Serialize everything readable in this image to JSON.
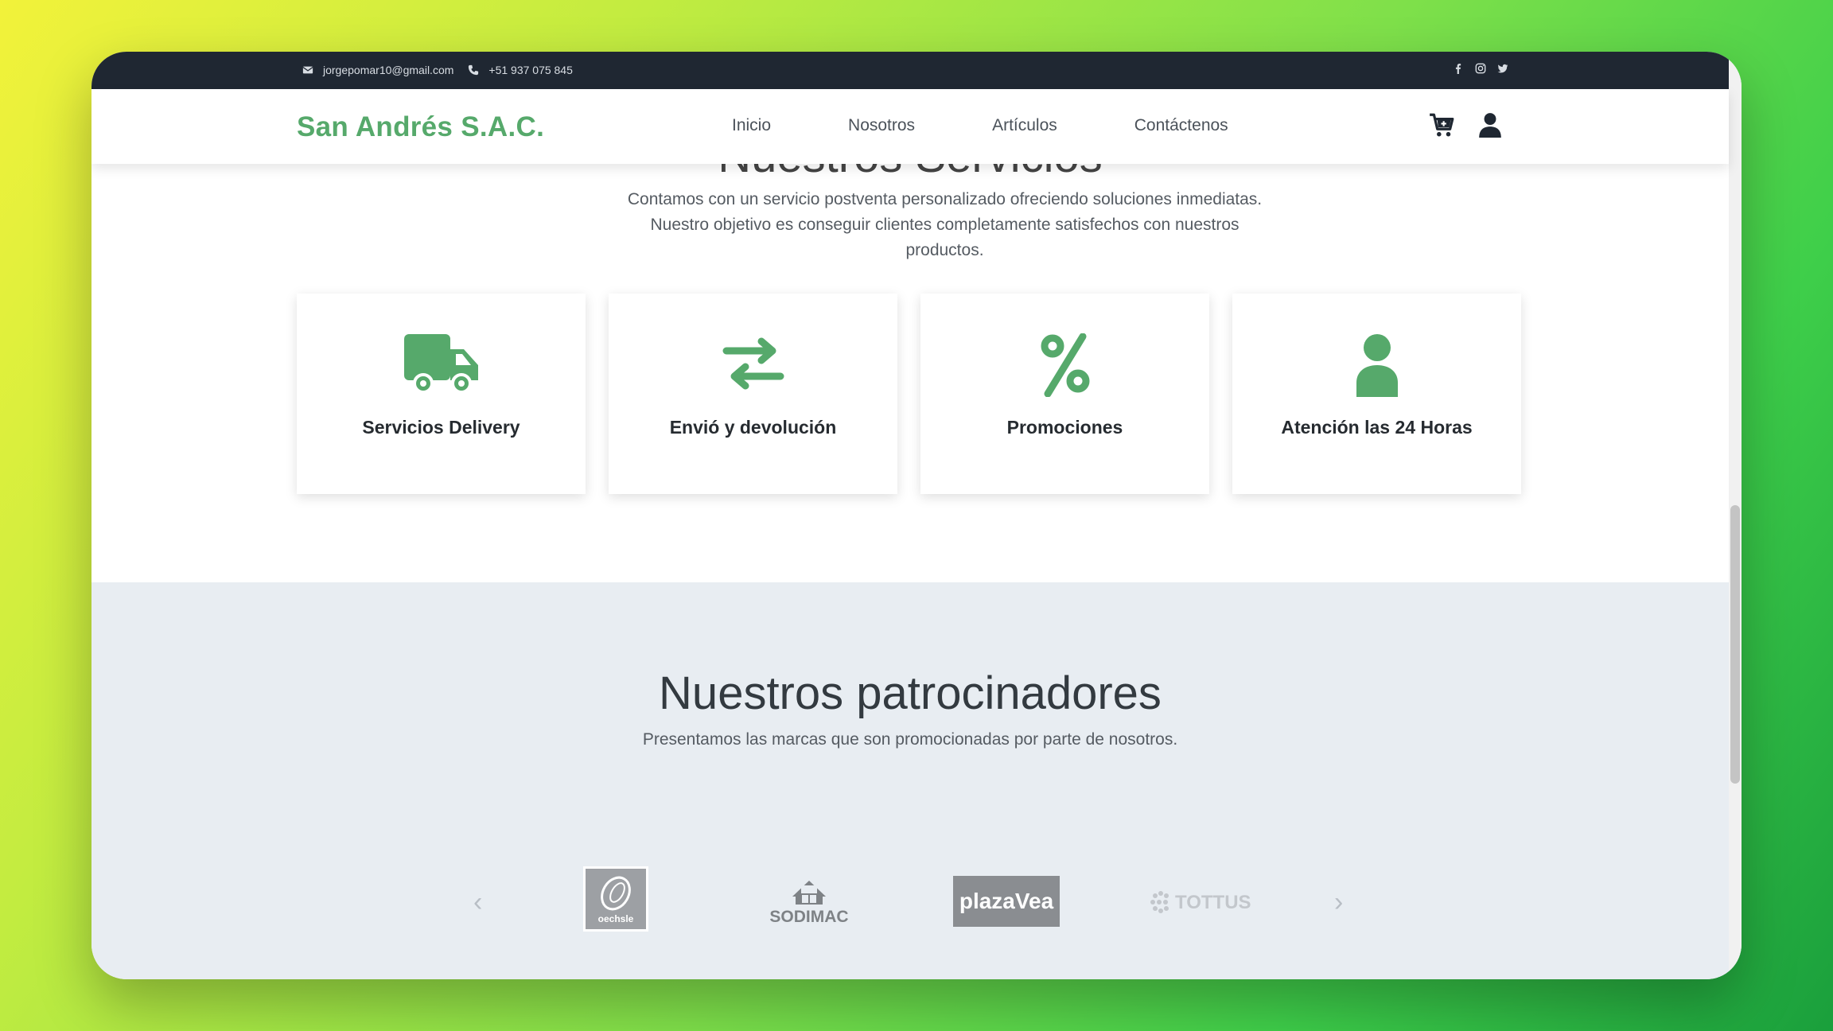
{
  "topbar": {
    "email": "jorgepomar10@gmail.com",
    "phone": "+51 937 075 845",
    "social": [
      "facebook-icon",
      "instagram-icon",
      "twitter-icon"
    ]
  },
  "navbar": {
    "brand": "San Andrés S.A.C.",
    "menu": [
      "Inicio",
      "Nosotros",
      "Artículos",
      "Contáctenos"
    ],
    "icons": [
      "cart-plus-icon",
      "user-icon"
    ]
  },
  "services": {
    "title": "Nuestros Servicios",
    "description": "Contamos con un servicio postventa personalizado ofreciendo soluciones inmediatas. Nuestro objetivo es conseguir clientes completamente satisfechos con nuestros productos.",
    "cards": [
      {
        "label": "Servicios Delivery",
        "icon": "truck-icon"
      },
      {
        "label": "Envió y devolución",
        "icon": "exchange-arrows-icon"
      },
      {
        "label": "Promociones",
        "icon": "percent-icon"
      },
      {
        "label": "Atención las 24 Horas",
        "icon": "user-icon"
      }
    ]
  },
  "sponsors": {
    "title": "Nuestros patrocinadores",
    "subtitle": "Presentamos las marcas que son promocionadas por parte de nosotros.",
    "logos": [
      "oechsle",
      "SODIMAC",
      "plazaVea",
      "TOTTUS"
    ],
    "prev": "‹",
    "next": "›"
  },
  "colors": {
    "accent": "#56a96b",
    "topbar": "#1f2732",
    "sponsors_bg": "#e8edf2"
  }
}
